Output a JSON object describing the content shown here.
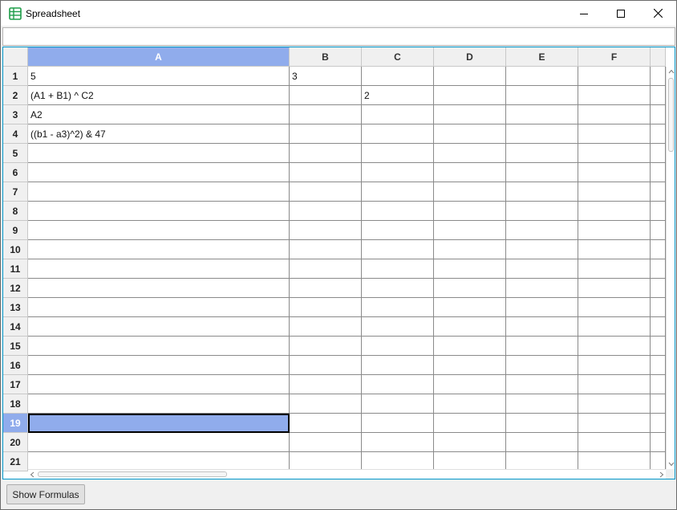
{
  "window": {
    "title": "Spreadsheet",
    "icon": "spreadsheet-icon",
    "accent_color": "#1e9d49"
  },
  "formula_bar": {
    "value": ""
  },
  "colors": {
    "selection": "#90acec",
    "grid_border": "#0096c9"
  },
  "grid": {
    "columns": [
      "A",
      "B",
      "C",
      "D",
      "E",
      "F"
    ],
    "selected_column": "A",
    "rows": [
      "1",
      "2",
      "3",
      "4",
      "5",
      "6",
      "7",
      "8",
      "9",
      "10",
      "11",
      "12",
      "13",
      "14",
      "15",
      "16",
      "17",
      "18",
      "19",
      "20",
      "21"
    ],
    "selected_row": "19",
    "cells": [
      {
        "ref": "A1",
        "col": "A",
        "row": "1",
        "value": "5"
      },
      {
        "ref": "B1",
        "col": "B",
        "row": "1",
        "value": "3"
      },
      {
        "ref": "A2",
        "col": "A",
        "row": "2",
        "value": "(A1 + B1) ^ C2"
      },
      {
        "ref": "C2",
        "col": "C",
        "row": "2",
        "value": "2"
      },
      {
        "ref": "A3",
        "col": "A",
        "row": "3",
        "value": "A2"
      },
      {
        "ref": "A4",
        "col": "A",
        "row": "4",
        "value": "((b1 - a3)^2) & 47"
      }
    ],
    "active_cell": "A19"
  },
  "bottom": {
    "show_formulas_label": "Show Formulas"
  }
}
